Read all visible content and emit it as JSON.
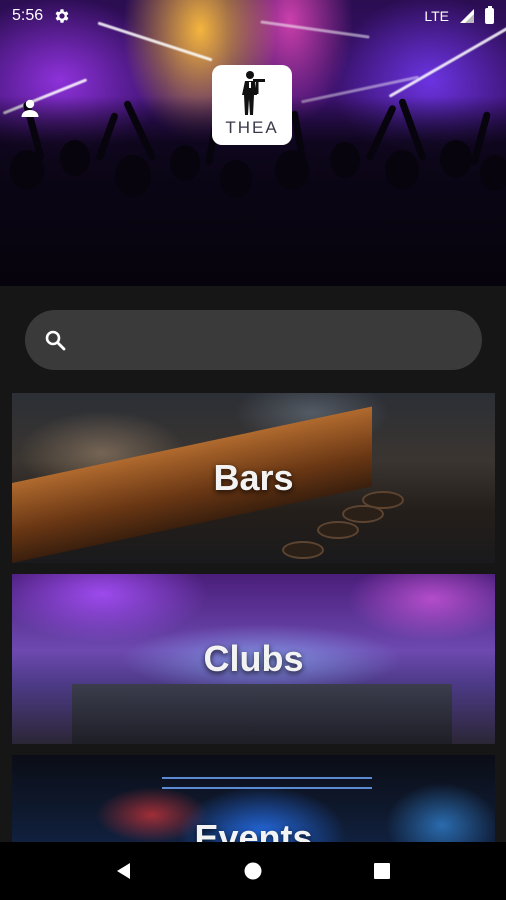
{
  "status_bar": {
    "time": "5:56",
    "network": "LTE"
  },
  "header": {
    "logo_text": "THEA",
    "profile_icon": "person-icon"
  },
  "search": {
    "placeholder": "",
    "value": "",
    "icon": "search-icon"
  },
  "categories": [
    {
      "label": "Bars"
    },
    {
      "label": "Clubs"
    },
    {
      "label": "Events"
    }
  ],
  "nav_bar": {
    "icons": [
      "back-icon",
      "home-icon",
      "recents-icon"
    ]
  }
}
